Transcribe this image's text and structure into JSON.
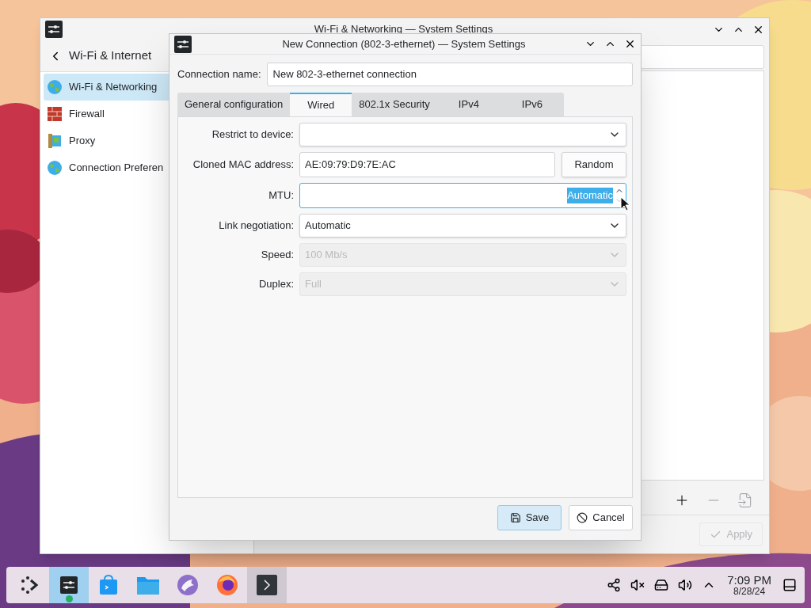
{
  "back_window": {
    "title": "Wi-Fi & Networking — System Settings",
    "header": "Wi-Fi & Internet",
    "sidebar": {
      "items": [
        {
          "label": "Wi-Fi & Networking",
          "kind": "globe",
          "selected": true
        },
        {
          "label": "Firewall",
          "kind": "firewall",
          "selected": false
        },
        {
          "label": "Proxy",
          "kind": "proxy",
          "selected": false
        },
        {
          "label": "Connection Preferen",
          "kind": "globe",
          "selected": false
        }
      ]
    },
    "apply_button": {
      "label": "Apply",
      "disabled": true
    }
  },
  "dialog": {
    "title": "New Connection (802-3-ethernet) — System Settings",
    "connection_name": {
      "label": "Connection name:",
      "value": "New 802-3-ethernet connection"
    },
    "tabs": [
      {
        "label": "General configuration",
        "selected": false
      },
      {
        "label": "Wired",
        "selected": true
      },
      {
        "label": "802.1x Security",
        "selected": false
      },
      {
        "label": "IPv4",
        "selected": false
      },
      {
        "label": "IPv6",
        "selected": false
      }
    ],
    "fields": [
      {
        "kind": "combo",
        "label": "Restrict to device:",
        "disabled": false
      },
      {
        "kind": "text_button",
        "label": "Cloned MAC address:",
        "value": "AE:09:79:D9:7E:AC",
        "button": "Random"
      },
      {
        "kind": "spin",
        "label": "MTU:",
        "value": "Automatic",
        "text_selected": true
      },
      {
        "kind": "combo",
        "label": "Link negotiation:",
        "value": "Automatic",
        "disabled": false
      },
      {
        "kind": "combo",
        "label": "Speed:",
        "value": "100 Mb/s",
        "disabled": true
      },
      {
        "kind": "combo",
        "label": "Duplex:",
        "value": "Full",
        "disabled": true
      }
    ],
    "buttons": [
      {
        "kind": "save",
        "label": "Save",
        "default": true
      },
      {
        "kind": "cancel",
        "label": "Cancel",
        "default": false
      }
    ]
  },
  "taskbar": {
    "apps": [
      {
        "kind": "launcher",
        "active": false,
        "running": false
      },
      {
        "kind": "settings",
        "active": true,
        "running": true
      },
      {
        "kind": "store",
        "active": false,
        "running": false
      },
      {
        "kind": "files",
        "active": false,
        "running": false
      },
      {
        "kind": "bird",
        "active": false,
        "running": false
      },
      {
        "kind": "browser",
        "active": false,
        "running": false
      },
      {
        "kind": "terminal",
        "active": false,
        "running": true
      }
    ],
    "clock": {
      "time": "7:09 PM",
      "date": "8/28/24"
    }
  }
}
